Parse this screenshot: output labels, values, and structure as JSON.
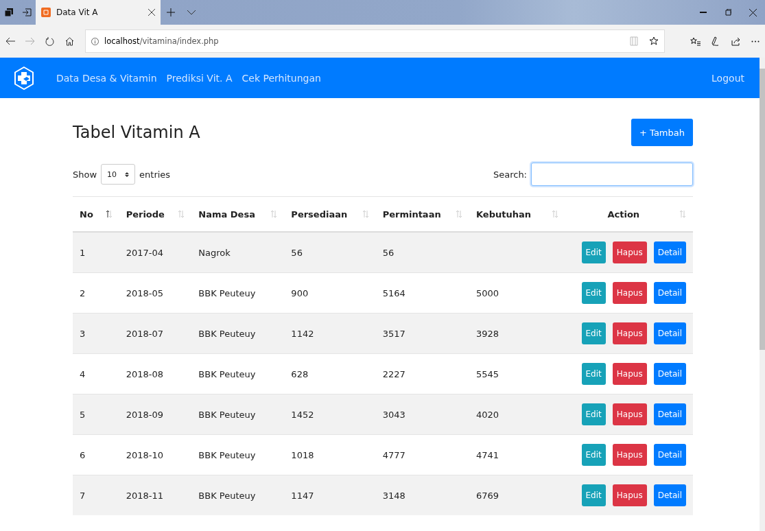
{
  "browser": {
    "tab_title": "Data Vit A",
    "url_host": "localhost",
    "url_path": "/vitamina/index.php"
  },
  "navbar": {
    "links": [
      "Data Desa & Vitamin",
      "Prediksi Vit. A",
      "Cek Perhitungan"
    ],
    "logout": "Logout"
  },
  "page": {
    "title": "Tabel Vitamin A",
    "add_button": "+ Tambah",
    "show_label": "Show",
    "entries_value": "10",
    "entries_label": "entries",
    "search_label": "Search:"
  },
  "table": {
    "columns": [
      {
        "label": "No",
        "sorted": true
      },
      {
        "label": "Periode",
        "sorted": false
      },
      {
        "label": "Nama Desa",
        "sorted": false
      },
      {
        "label": "Persediaan",
        "sorted": false
      },
      {
        "label": "Permintaan",
        "sorted": false
      },
      {
        "label": "Kebutuhan",
        "sorted": false
      },
      {
        "label": "Action",
        "sorted": false
      }
    ],
    "rows": [
      {
        "cells": [
          "1",
          "2017-04",
          "Nagrok",
          "56",
          "56",
          ""
        ],
        "actions": [
          "Edit",
          "Hapus",
          "Detail"
        ]
      },
      {
        "cells": [
          "2",
          "2018-05",
          "BBK Peuteuy",
          "900",
          "5164",
          "5000"
        ],
        "actions": [
          "Edit",
          "Hapus",
          "Detail"
        ]
      },
      {
        "cells": [
          "3",
          "2018-07",
          "BBK Peuteuy",
          "1142",
          "3517",
          "3928"
        ],
        "actions": [
          "Edit",
          "Hapus",
          "Detail"
        ]
      },
      {
        "cells": [
          "4",
          "2018-08",
          "BBK Peuteuy",
          "628",
          "2227",
          "5545"
        ],
        "actions": [
          "Edit",
          "Hapus",
          "Detail"
        ]
      },
      {
        "cells": [
          "5",
          "2018-09",
          "BBK Peuteuy",
          "1452",
          "3043",
          "4020"
        ],
        "actions": [
          "Edit",
          "Hapus",
          "Detail"
        ]
      },
      {
        "cells": [
          "6",
          "2018-10",
          "BBK Peuteuy",
          "1018",
          "4777",
          "4741"
        ],
        "actions": [
          "Edit",
          "Hapus",
          "Detail"
        ]
      },
      {
        "cells": [
          "7",
          "2018-11",
          "BBK Peuteuy",
          "1147",
          "3148",
          "6769"
        ],
        "actions": [
          "Edit",
          "Hapus",
          "Detail"
        ]
      }
    ]
  }
}
